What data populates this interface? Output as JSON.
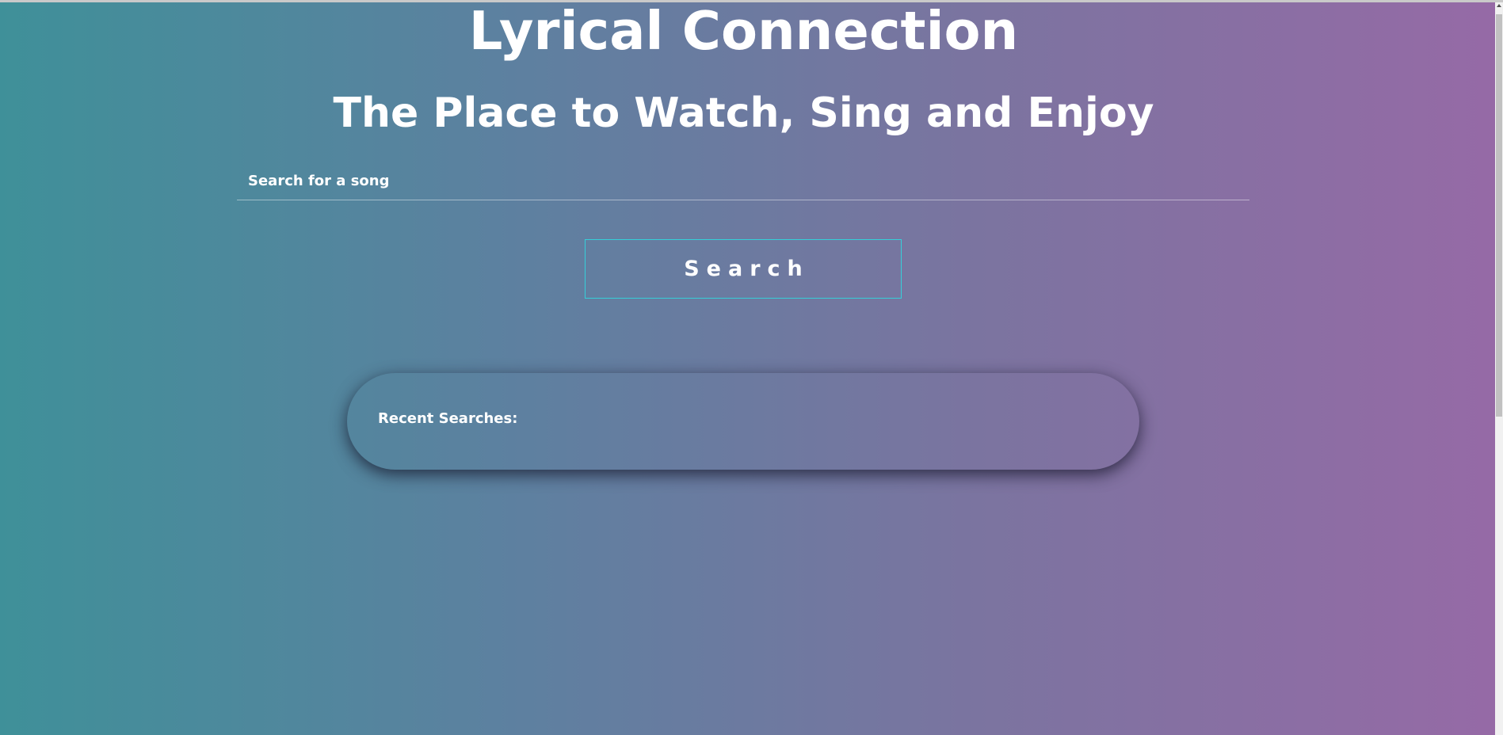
{
  "header": {
    "title": "Lyrical Connection",
    "subtitle": "The Place to Watch, Sing and Enjoy"
  },
  "search": {
    "placeholder": "Search for a song",
    "value": "",
    "button_label": "Search"
  },
  "recent": {
    "label": "Recent Searches:",
    "items": []
  },
  "colors": {
    "gradient_left": "#3f9099",
    "gradient_right": "#966aa6",
    "button_border": "#35cfd9"
  }
}
